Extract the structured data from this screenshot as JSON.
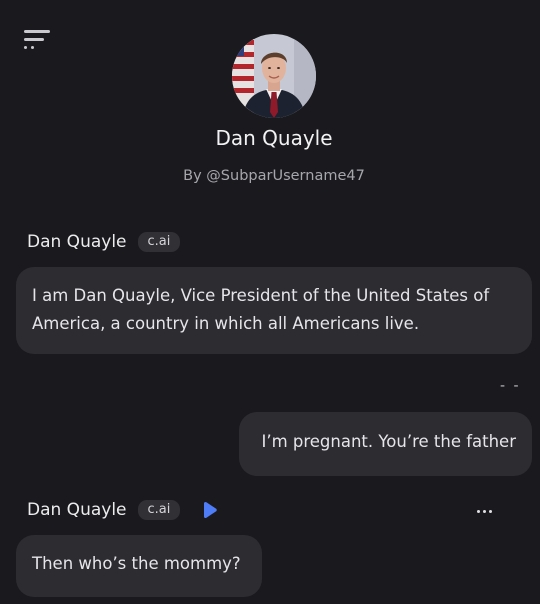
{
  "header": {
    "character_name": "Dan Quayle",
    "creator": "By @SubparUsername47"
  },
  "messages": [
    {
      "author": "Dan Quayle",
      "badge": "c.ai",
      "text": "I am Dan Quayle, Vice President of the United States of America, a country in which all Americans live."
    },
    {
      "menu": "- -",
      "text": "I’m pregnant. You’re the father"
    },
    {
      "author": "Dan Quayle",
      "badge": "c.ai",
      "text": "Then who’s the mommy?"
    }
  ],
  "colors": {
    "background": "#1a1a1e",
    "bubble": "#2c2c31",
    "play_icon": "#4f7cf7"
  },
  "icons": {
    "menu": "hamburger-menu-icon",
    "play": "play-icon",
    "more": "more-horizontal-icon"
  }
}
